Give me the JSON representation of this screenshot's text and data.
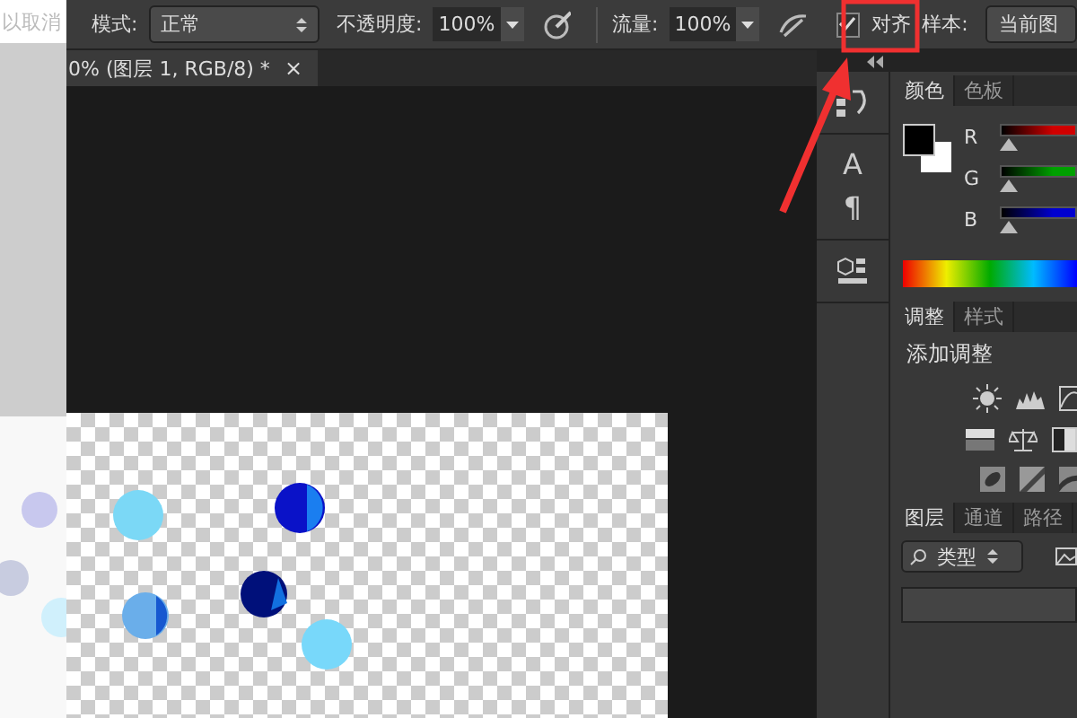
{
  "background_window": {
    "text": "以取消"
  },
  "options_bar": {
    "mode_label": "模式:",
    "mode_value": "正常",
    "opacity_label": "不透明度:",
    "opacity_value": "100%",
    "flow_label": "流量:",
    "flow_value": "100%",
    "align": {
      "label": "对齐",
      "checked": true
    },
    "sample_label": "样本:",
    "sample_value": "当前图"
  },
  "document_tab": {
    "title": "0% (图层 1, RGB/8) *",
    "close": "×"
  },
  "dock": {
    "character_glyph": "A",
    "paragraph_glyph": "¶"
  },
  "color_panel": {
    "tabs": [
      {
        "label": "颜色",
        "selected": true
      },
      {
        "label": "色板",
        "selected": false
      }
    ],
    "channels": [
      {
        "label": "R",
        "color": "#d00000",
        "level": 0
      },
      {
        "label": "G",
        "color": "#00a000",
        "level": 0
      },
      {
        "label": "B",
        "color": "#0000d0",
        "level": 0
      }
    ]
  },
  "adjustments_panel": {
    "tabs": [
      {
        "label": "调整",
        "selected": true
      },
      {
        "label": "样式",
        "selected": false
      }
    ],
    "title": "添加调整"
  },
  "layers_panel": {
    "tabs": [
      {
        "label": "图层",
        "selected": true
      },
      {
        "label": "通道",
        "selected": false
      },
      {
        "label": "路径",
        "selected": false
      }
    ],
    "filter": "类型"
  }
}
